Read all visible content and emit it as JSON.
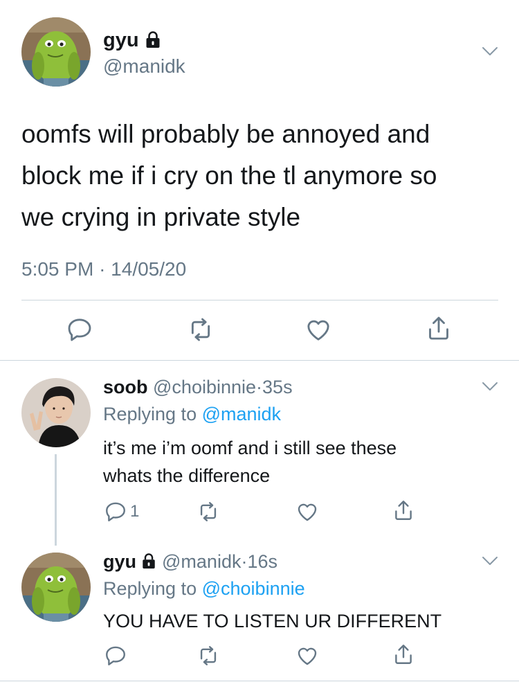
{
  "main_tweet": {
    "name": "gyu",
    "handle": "@manidk",
    "text_lines": [
      "oomfs will probably be annoyed and",
      "block me if i cry on the tl anymore so",
      "we crying in private style"
    ],
    "time": "5:05 PM",
    "date_separator": "·",
    "date": "14/05/20"
  },
  "reply1": {
    "name": "soob",
    "handle": "@choibinnie",
    "separator": "·",
    "time_ago": "35s",
    "replying_prefix": "Replying to",
    "replying_to": "@manidk",
    "text_lines": [
      "it’s me i’m oomf and i still see these",
      "whats the difference"
    ],
    "reply_count": "1"
  },
  "reply2": {
    "name": "gyu",
    "handle": "@manidk",
    "separator": "·",
    "time_ago": "16s",
    "replying_prefix": "Replying to",
    "replying_to": "@choibinnie",
    "text": "YOU HAVE TO LISTEN UR DIFFERENT"
  },
  "icons": {
    "lock": "lock-icon",
    "chevron": "chevron-down-icon",
    "reply": "reply-icon",
    "retweet": "retweet-icon",
    "like": "heart-icon",
    "share": "share-icon"
  },
  "colors": {
    "text": "#14171a",
    "muted": "#657786",
    "link": "#1da1f2",
    "divider": "#ccd6dd",
    "thread_line": "#ccd6dd"
  }
}
